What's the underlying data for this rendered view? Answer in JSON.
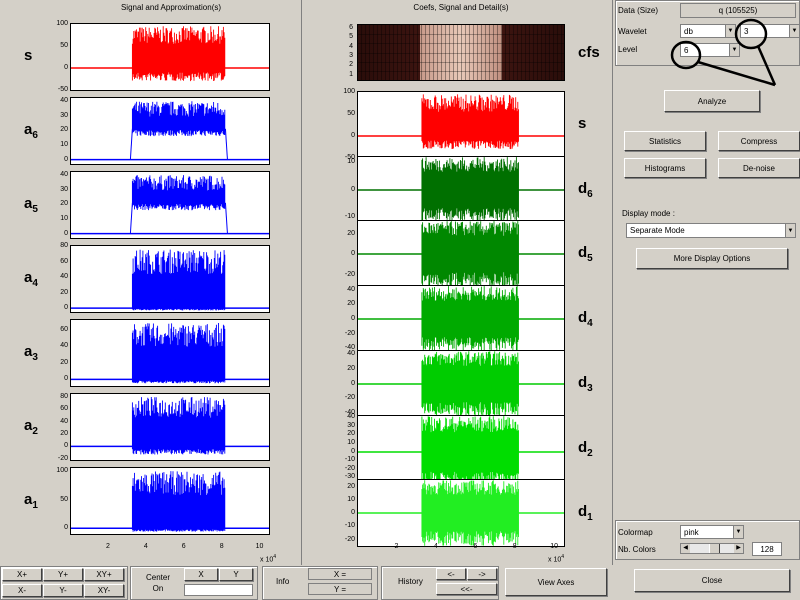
{
  "left_panel": {
    "title": "Signal and Approximation(s)",
    "x_ticks": [
      "2",
      "4",
      "6",
      "8",
      "10"
    ],
    "x_exponent": "x 10",
    "x_exponent_power": "4",
    "plots": [
      {
        "label": "s",
        "sub": "",
        "color": "#ff0000",
        "y_ticks": [
          "100",
          "50",
          "0",
          "-50"
        ],
        "ylim": [
          -50,
          100
        ],
        "kind": "signal"
      },
      {
        "label": "a",
        "sub": "6",
        "color": "#0000ff",
        "y_ticks": [
          "40",
          "30",
          "20",
          "10",
          "0"
        ],
        "ylim": [
          -3,
          42
        ],
        "kind": "approx"
      },
      {
        "label": "a",
        "sub": "5",
        "color": "#0000ff",
        "y_ticks": [
          "40",
          "30",
          "20",
          "10",
          "0"
        ],
        "ylim": [
          -3,
          42
        ],
        "kind": "approx"
      },
      {
        "label": "a",
        "sub": "4",
        "color": "#0000ff",
        "y_ticks": [
          "80",
          "60",
          "40",
          "20",
          "0"
        ],
        "ylim": [
          -5,
          80
        ],
        "kind": "signal"
      },
      {
        "label": "a",
        "sub": "3",
        "color": "#0000ff",
        "y_ticks": [
          "60",
          "40",
          "20",
          "0"
        ],
        "ylim": [
          -8,
          72
        ],
        "kind": "signal"
      },
      {
        "label": "a",
        "sub": "2",
        "color": "#0000ff",
        "y_ticks": [
          "80",
          "60",
          "40",
          "20",
          "0",
          "-20"
        ],
        "ylim": [
          -22,
          85
        ],
        "kind": "signal"
      },
      {
        "label": "a",
        "sub": "1",
        "color": "#0000ff",
        "y_ticks": [
          "100",
          "50",
          "0"
        ],
        "ylim": [
          -10,
          105
        ],
        "kind": "signal"
      }
    ]
  },
  "right_panel": {
    "title": "Coefs, Signal and Detail(s)",
    "cfs_label": "cfs",
    "cfs_levels": [
      "6",
      "5",
      "4",
      "3",
      "2",
      "1"
    ],
    "x_ticks": [
      "2",
      "4",
      "6",
      "8",
      "10"
    ],
    "x_exponent": "x 10",
    "x_exponent_power": "4",
    "plots": [
      {
        "label": "s",
        "sub": "",
        "color": "#ff0000",
        "y_ticks": [
          "100",
          "50",
          "0",
          "-50"
        ],
        "ylim": [
          -50,
          100
        ],
        "kind": "signal"
      },
      {
        "label": "d",
        "sub": "6",
        "color": "#007000",
        "y_ticks": [
          "10",
          "0",
          "-10"
        ],
        "ylim": [
          -12,
          12
        ],
        "kind": "detail"
      },
      {
        "label": "d",
        "sub": "5",
        "color": "#008800",
        "y_ticks": [
          "20",
          "0",
          "-20"
        ],
        "ylim": [
          -32,
          32
        ],
        "kind": "detail"
      },
      {
        "label": "d",
        "sub": "4",
        "color": "#00aa00",
        "y_ticks": [
          "40",
          "20",
          "0",
          "-20",
          "-40"
        ],
        "ylim": [
          -45,
          45
        ],
        "kind": "detail"
      },
      {
        "label": "d",
        "sub": "3",
        "color": "#00cc00",
        "y_ticks": [
          "40",
          "20",
          "0",
          "-20",
          "-40"
        ],
        "ylim": [
          -45,
          45
        ],
        "kind": "detail"
      },
      {
        "label": "d",
        "sub": "2",
        "color": "#00dd00",
        "y_ticks": [
          "40",
          "30",
          "20",
          "10",
          "0",
          "-10",
          "-20",
          "-30"
        ],
        "ylim": [
          -35,
          42
        ],
        "kind": "detail"
      },
      {
        "label": "d",
        "sub": "1",
        "color": "#22ee22",
        "y_ticks": [
          "20",
          "10",
          "0",
          "-10",
          "-20"
        ],
        "ylim": [
          -25,
          25
        ],
        "kind": "detail"
      }
    ]
  },
  "controls": {
    "data_label": "Data  (Size)",
    "data_value": "q  (105525)",
    "wavelet_label": "Wavelet",
    "wavelet_family": "db",
    "wavelet_order": "3",
    "level_label": "Level",
    "level_value": "6",
    "analyze": "Analyze",
    "statistics": "Statistics",
    "compress": "Compress",
    "histograms": "Histograms",
    "denoise": "De-noise",
    "display_mode_label": "Display mode :",
    "display_mode_value": "Separate Mode",
    "more_display": "More Display Options",
    "colormap_label": "Colormap",
    "colormap_value": "pink",
    "nb_colors_label": "Nb. Colors",
    "nb_colors_value": "128",
    "close": "Close"
  },
  "bottom_bar": {
    "xplus": "X+",
    "yplus": "Y+",
    "xyplus": "XY+",
    "xminus": "X-",
    "yminus": "Y-",
    "xyminus": "XY-",
    "center_on": "Center",
    "center_on2": "On",
    "x_btn": "X",
    "y_btn": "Y",
    "info_label": "Info",
    "x_eq": "X =",
    "y_eq": "Y =",
    "history_label": "History",
    "hist_prev": "<-",
    "hist_next": "->",
    "hist_first": "<<-",
    "view_axes": "View Axes"
  }
}
